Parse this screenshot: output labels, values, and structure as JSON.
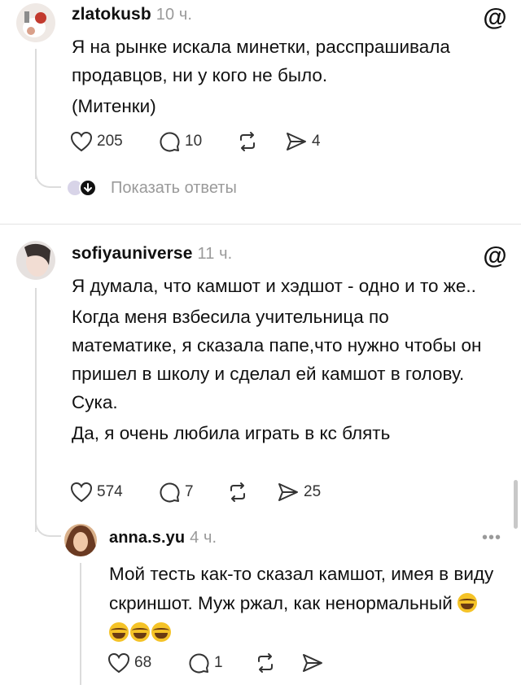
{
  "posts": [
    {
      "username": "zlatokusb",
      "time": "10 ч.",
      "paragraphs": [
        "Я на рынке искала минетки, расспрашивала продавцов, ни у кого не было.",
        "(Митенки)"
      ],
      "likes": "205",
      "comments": "10",
      "shares": "4",
      "show_replies": "Показать ответы",
      "avatar_colors": [
        "#f2ece8",
        "#c23a2e"
      ]
    },
    {
      "username": "sofiyauniverse",
      "time": "11 ч.",
      "paragraphs": [
        "Я думала, что камшот и хэдшот - одно и то же..",
        "Когда меня взбесила учительница по математике, я сказала папе,что нужно чтобы он пришел в школу и сделал ей камшот в голову. Сука.",
        "Да, я очень любила играть в кс блять"
      ],
      "likes": "574",
      "comments": "7",
      "shares": "25",
      "avatar_colors": [
        "#e8e4e2",
        "#3a3230"
      ]
    }
  ],
  "reply": {
    "username": "anna.s.yu",
    "time": "4 ч.",
    "text": "Мой тесть как-то сказал камшот, имея в виду скриншот. Муж ржал, как ненормальный",
    "emoji_count": 4,
    "emoji_name": "face-with-tears-of-joy",
    "likes": "68",
    "comments": "1",
    "more": "•••",
    "avatar_colors": [
      "#c58a5a",
      "#5a3320"
    ]
  }
}
